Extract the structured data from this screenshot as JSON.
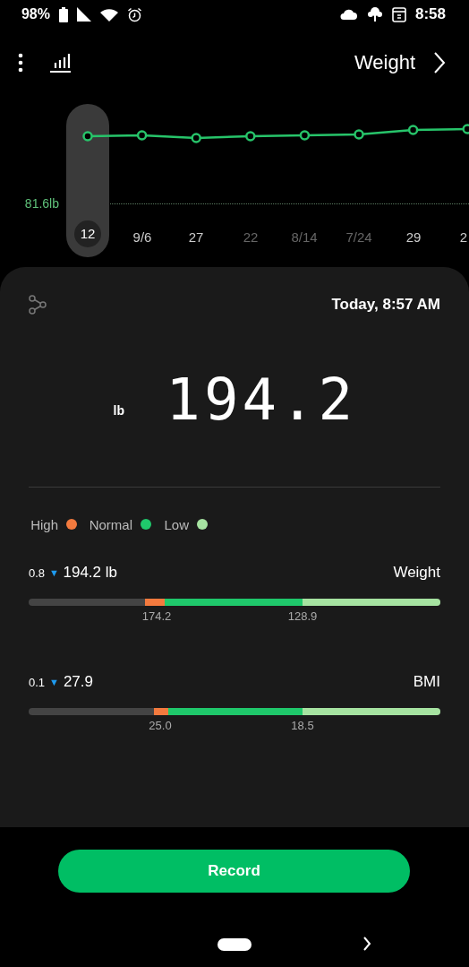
{
  "status_bar": {
    "time": "8:58",
    "battery": "98%"
  },
  "header": {
    "title": "Weight"
  },
  "chart": {
    "reference": "81.6lb",
    "points": [
      {
        "label": "12",
        "selected": true,
        "dimmed": false
      },
      {
        "label": "9/6",
        "selected": false,
        "dimmed": false
      },
      {
        "label": "27",
        "selected": false,
        "dimmed": false
      },
      {
        "label": "22",
        "selected": false,
        "dimmed": true
      },
      {
        "label": "8/14",
        "selected": false,
        "dimmed": true
      },
      {
        "label": "7/24",
        "selected": false,
        "dimmed": true
      },
      {
        "label": "29",
        "selected": false,
        "dimmed": false
      },
      {
        "label": "2",
        "selected": false,
        "dimmed": false
      }
    ]
  },
  "card": {
    "timestamp": "Today, 8:57 AM",
    "value": "194.2",
    "unit": "lb",
    "legend": [
      {
        "label": "High",
        "color": "#f37a3e"
      },
      {
        "label": "Normal",
        "color": "#1fc86b"
      },
      {
        "label": "Low",
        "color": "#a6e3a1"
      }
    ],
    "metrics": [
      {
        "name": "Weight",
        "value": "194.2 lb",
        "trend": "▼",
        "change": "0.8",
        "thresholds": [
          "174.2",
          "128.9"
        ]
      },
      {
        "name": "BMI",
        "value": "27.9",
        "trend": "▼",
        "change": "0.1",
        "thresholds": [
          "25.0",
          "18.5"
        ]
      }
    ]
  },
  "record_button": {
    "label": "Record"
  }
}
